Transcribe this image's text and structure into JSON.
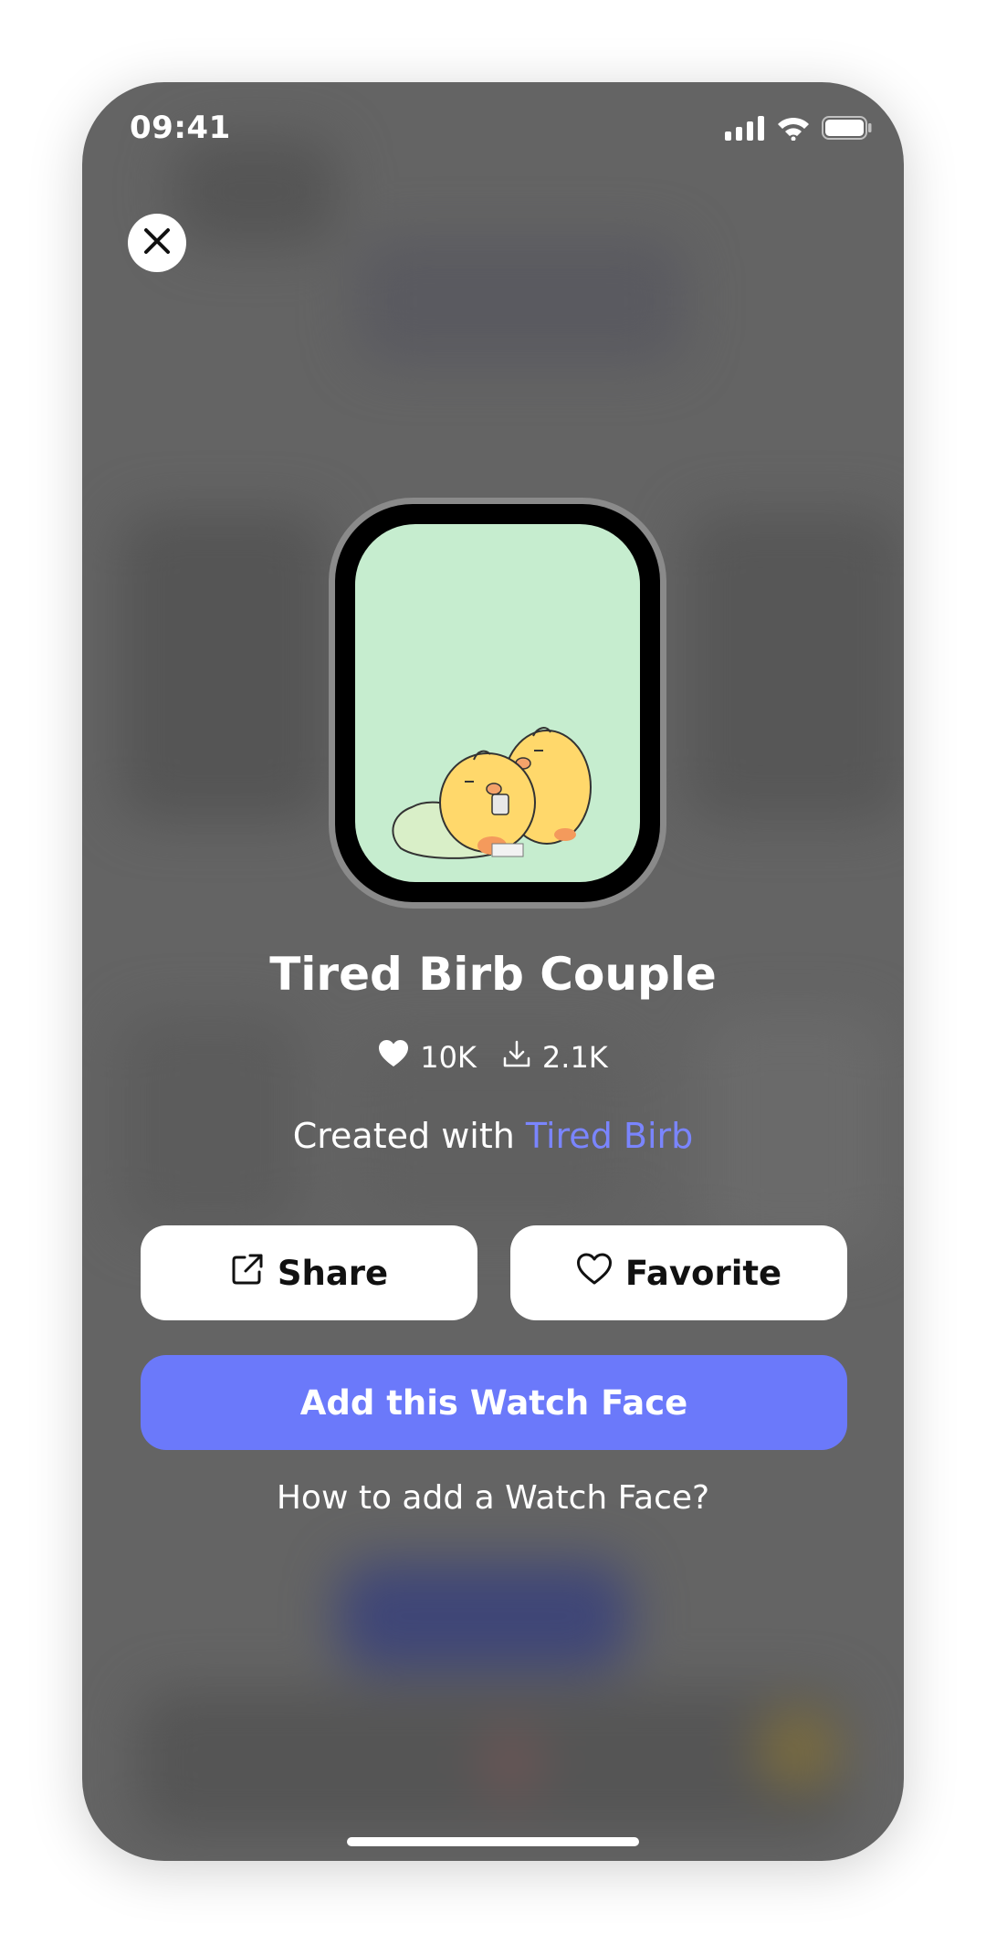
{
  "status_bar": {
    "time": "09:41"
  },
  "watch_face": {
    "title": "Tired Birb Couple",
    "likes": "10K",
    "downloads": "2.1K",
    "created_with_prefix": "Created with",
    "creator": "Tired Birb",
    "screen_color": "#c6edcf"
  },
  "actions": {
    "share_label": "Share",
    "favorite_label": "Favorite",
    "add_label": "Add this Watch Face",
    "howto_label": "How to add a Watch Face?"
  },
  "colors": {
    "accent": "#6b79fa",
    "link": "#7a85ff",
    "overlay": "#646464"
  },
  "icons": [
    "close-icon",
    "signal-icon",
    "wifi-icon",
    "battery-icon",
    "heart-icon",
    "download-icon",
    "share-icon",
    "heart-outline-icon"
  ]
}
